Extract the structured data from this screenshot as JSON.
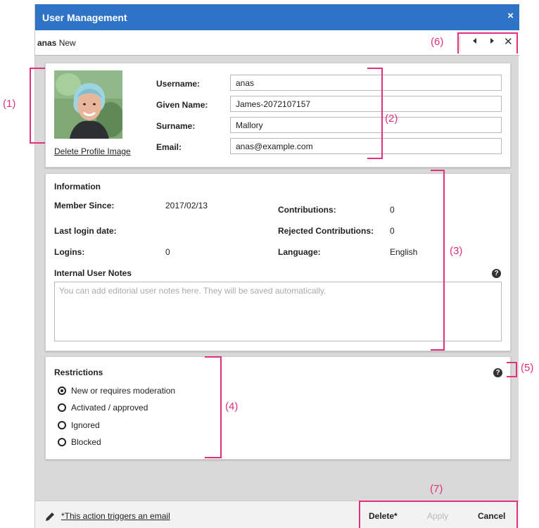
{
  "window": {
    "title": "User Management",
    "close_glyph": "×"
  },
  "subbar": {
    "username": "anas",
    "status": "New",
    "prev_glyph": "◀",
    "next_glyph": "▶",
    "close_glyph": "✕"
  },
  "profile": {
    "delete_image_label": "Delete Profile Image",
    "fields": {
      "username": {
        "label": "Username:",
        "value": "anas"
      },
      "given_name": {
        "label": "Given Name:",
        "value": "James-2072107157"
      },
      "surname": {
        "label": "Surname:",
        "value": "Mallory"
      },
      "email": {
        "label": "Email:",
        "value": "anas@example.com"
      }
    }
  },
  "information": {
    "title": "Information",
    "member_since": {
      "label": "Member Since:",
      "value": "2017/02/13"
    },
    "contributions": {
      "label": "Contributions:",
      "value": "0"
    },
    "last_login": {
      "label": "Last login date:",
      "value": ""
    },
    "rejected": {
      "label": "Rejected Contributions:",
      "value": "0"
    },
    "logins": {
      "label": "Logins:",
      "value": "0"
    },
    "language": {
      "label": "Language:",
      "value": "English"
    },
    "notes_title": "Internal User Notes",
    "notes_placeholder": "You can add editorial user notes here. They will be saved automatically.",
    "help_glyph": "?"
  },
  "restrictions": {
    "title": "Restrictions",
    "help_glyph": "?",
    "selected": "New or requires moderation",
    "options": [
      "New or requires moderation",
      "Activated / approved",
      "Ignored",
      "Blocked"
    ]
  },
  "footer": {
    "note": "*This action triggers an email",
    "delete_label": "Delete*",
    "apply_label": "Apply",
    "cancel_label": "Cancel"
  },
  "annotations": {
    "a1": "(1)",
    "a2": "(2)",
    "a3": "(3)",
    "a4": "(4)",
    "a5": "(5)",
    "a6": "(6)",
    "a7": "(7)"
  },
  "colors": {
    "titlebar": "#2e73c6",
    "annotation": "#e0307e",
    "dialog_bg": "#d9d9d9",
    "disabled_text": "#bbbbbb"
  },
  "icons": {
    "help": "help-circle-icon",
    "pencil": "pencil-icon",
    "close": "close-icon",
    "prev": "chevron-left-icon",
    "next": "chevron-right-icon"
  }
}
